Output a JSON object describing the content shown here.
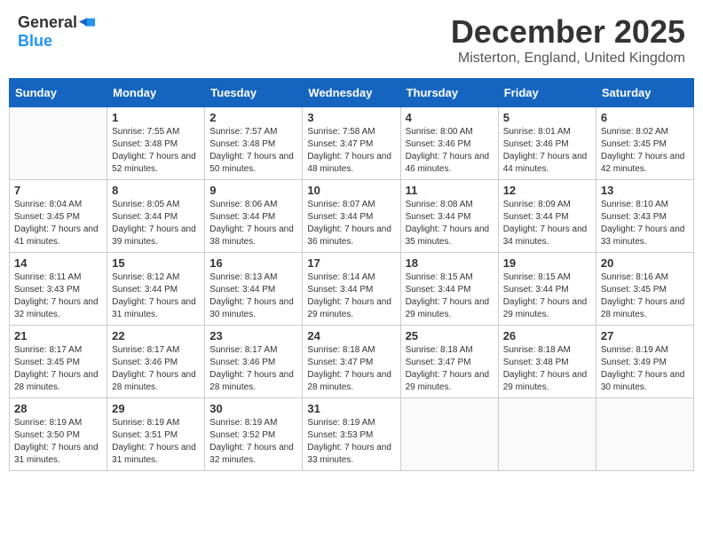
{
  "logo": {
    "general": "General",
    "blue": "Blue"
  },
  "title": "December 2025",
  "location": "Misterton, England, United Kingdom",
  "weekdays": [
    "Sunday",
    "Monday",
    "Tuesday",
    "Wednesday",
    "Thursday",
    "Friday",
    "Saturday"
  ],
  "weeks": [
    [
      {
        "day": "",
        "sunrise": "",
        "sunset": "",
        "daylight": ""
      },
      {
        "day": "1",
        "sunrise": "7:55 AM",
        "sunset": "3:48 PM",
        "daylight": "7 hours and 52 minutes."
      },
      {
        "day": "2",
        "sunrise": "7:57 AM",
        "sunset": "3:48 PM",
        "daylight": "7 hours and 50 minutes."
      },
      {
        "day": "3",
        "sunrise": "7:58 AM",
        "sunset": "3:47 PM",
        "daylight": "7 hours and 48 minutes."
      },
      {
        "day": "4",
        "sunrise": "8:00 AM",
        "sunset": "3:46 PM",
        "daylight": "7 hours and 46 minutes."
      },
      {
        "day": "5",
        "sunrise": "8:01 AM",
        "sunset": "3:46 PM",
        "daylight": "7 hours and 44 minutes."
      },
      {
        "day": "6",
        "sunrise": "8:02 AM",
        "sunset": "3:45 PM",
        "daylight": "7 hours and 42 minutes."
      }
    ],
    [
      {
        "day": "7",
        "sunrise": "8:04 AM",
        "sunset": "3:45 PM",
        "daylight": "7 hours and 41 minutes."
      },
      {
        "day": "8",
        "sunrise": "8:05 AM",
        "sunset": "3:44 PM",
        "daylight": "7 hours and 39 minutes."
      },
      {
        "day": "9",
        "sunrise": "8:06 AM",
        "sunset": "3:44 PM",
        "daylight": "7 hours and 38 minutes."
      },
      {
        "day": "10",
        "sunrise": "8:07 AM",
        "sunset": "3:44 PM",
        "daylight": "7 hours and 36 minutes."
      },
      {
        "day": "11",
        "sunrise": "8:08 AM",
        "sunset": "3:44 PM",
        "daylight": "7 hours and 35 minutes."
      },
      {
        "day": "12",
        "sunrise": "8:09 AM",
        "sunset": "3:44 PM",
        "daylight": "7 hours and 34 minutes."
      },
      {
        "day": "13",
        "sunrise": "8:10 AM",
        "sunset": "3:43 PM",
        "daylight": "7 hours and 33 minutes."
      }
    ],
    [
      {
        "day": "14",
        "sunrise": "8:11 AM",
        "sunset": "3:43 PM",
        "daylight": "7 hours and 32 minutes."
      },
      {
        "day": "15",
        "sunrise": "8:12 AM",
        "sunset": "3:44 PM",
        "daylight": "7 hours and 31 minutes."
      },
      {
        "day": "16",
        "sunrise": "8:13 AM",
        "sunset": "3:44 PM",
        "daylight": "7 hours and 30 minutes."
      },
      {
        "day": "17",
        "sunrise": "8:14 AM",
        "sunset": "3:44 PM",
        "daylight": "7 hours and 29 minutes."
      },
      {
        "day": "18",
        "sunrise": "8:15 AM",
        "sunset": "3:44 PM",
        "daylight": "7 hours and 29 minutes."
      },
      {
        "day": "19",
        "sunrise": "8:15 AM",
        "sunset": "3:44 PM",
        "daylight": "7 hours and 29 minutes."
      },
      {
        "day": "20",
        "sunrise": "8:16 AM",
        "sunset": "3:45 PM",
        "daylight": "7 hours and 28 minutes."
      }
    ],
    [
      {
        "day": "21",
        "sunrise": "8:17 AM",
        "sunset": "3:45 PM",
        "daylight": "7 hours and 28 minutes."
      },
      {
        "day": "22",
        "sunrise": "8:17 AM",
        "sunset": "3:46 PM",
        "daylight": "7 hours and 28 minutes."
      },
      {
        "day": "23",
        "sunrise": "8:17 AM",
        "sunset": "3:46 PM",
        "daylight": "7 hours and 28 minutes."
      },
      {
        "day": "24",
        "sunrise": "8:18 AM",
        "sunset": "3:47 PM",
        "daylight": "7 hours and 28 minutes."
      },
      {
        "day": "25",
        "sunrise": "8:18 AM",
        "sunset": "3:47 PM",
        "daylight": "7 hours and 29 minutes."
      },
      {
        "day": "26",
        "sunrise": "8:18 AM",
        "sunset": "3:48 PM",
        "daylight": "7 hours and 29 minutes."
      },
      {
        "day": "27",
        "sunrise": "8:19 AM",
        "sunset": "3:49 PM",
        "daylight": "7 hours and 30 minutes."
      }
    ],
    [
      {
        "day": "28",
        "sunrise": "8:19 AM",
        "sunset": "3:50 PM",
        "daylight": "7 hours and 31 minutes."
      },
      {
        "day": "29",
        "sunrise": "8:19 AM",
        "sunset": "3:51 PM",
        "daylight": "7 hours and 31 minutes."
      },
      {
        "day": "30",
        "sunrise": "8:19 AM",
        "sunset": "3:52 PM",
        "daylight": "7 hours and 32 minutes."
      },
      {
        "day": "31",
        "sunrise": "8:19 AM",
        "sunset": "3:53 PM",
        "daylight": "7 hours and 33 minutes."
      },
      {
        "day": "",
        "sunrise": "",
        "sunset": "",
        "daylight": ""
      },
      {
        "day": "",
        "sunrise": "",
        "sunset": "",
        "daylight": ""
      },
      {
        "day": "",
        "sunrise": "",
        "sunset": "",
        "daylight": ""
      }
    ]
  ],
  "labels": {
    "sunrise": "Sunrise:",
    "sunset": "Sunset:",
    "daylight": "Daylight:"
  }
}
